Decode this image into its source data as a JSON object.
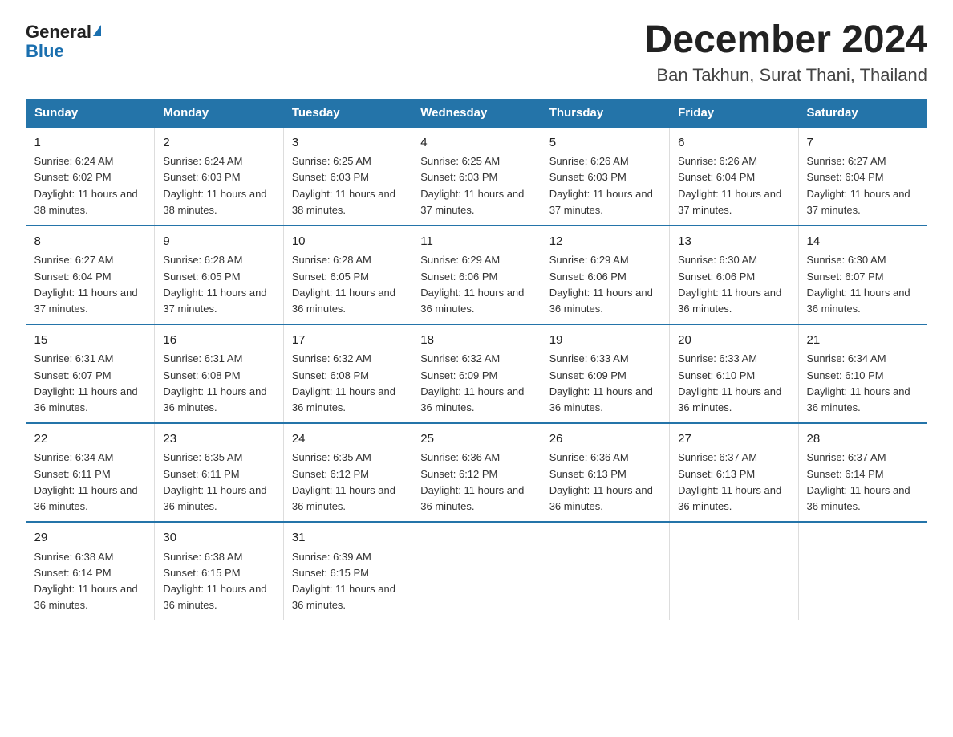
{
  "header": {
    "logo": {
      "general": "General",
      "blue": "Blue",
      "triangle": true
    },
    "title": "December 2024",
    "subtitle": "Ban Takhun, Surat Thani, Thailand"
  },
  "calendar": {
    "days_of_week": [
      "Sunday",
      "Monday",
      "Tuesday",
      "Wednesday",
      "Thursday",
      "Friday",
      "Saturday"
    ],
    "weeks": [
      [
        {
          "day": "1",
          "sunrise": "6:24 AM",
          "sunset": "6:02 PM",
          "daylight": "11 hours and 38 minutes."
        },
        {
          "day": "2",
          "sunrise": "6:24 AM",
          "sunset": "6:03 PM",
          "daylight": "11 hours and 38 minutes."
        },
        {
          "day": "3",
          "sunrise": "6:25 AM",
          "sunset": "6:03 PM",
          "daylight": "11 hours and 38 minutes."
        },
        {
          "day": "4",
          "sunrise": "6:25 AM",
          "sunset": "6:03 PM",
          "daylight": "11 hours and 37 minutes."
        },
        {
          "day": "5",
          "sunrise": "6:26 AM",
          "sunset": "6:03 PM",
          "daylight": "11 hours and 37 minutes."
        },
        {
          "day": "6",
          "sunrise": "6:26 AM",
          "sunset": "6:04 PM",
          "daylight": "11 hours and 37 minutes."
        },
        {
          "day": "7",
          "sunrise": "6:27 AM",
          "sunset": "6:04 PM",
          "daylight": "11 hours and 37 minutes."
        }
      ],
      [
        {
          "day": "8",
          "sunrise": "6:27 AM",
          "sunset": "6:04 PM",
          "daylight": "11 hours and 37 minutes."
        },
        {
          "day": "9",
          "sunrise": "6:28 AM",
          "sunset": "6:05 PM",
          "daylight": "11 hours and 37 minutes."
        },
        {
          "day": "10",
          "sunrise": "6:28 AM",
          "sunset": "6:05 PM",
          "daylight": "11 hours and 36 minutes."
        },
        {
          "day": "11",
          "sunrise": "6:29 AM",
          "sunset": "6:06 PM",
          "daylight": "11 hours and 36 minutes."
        },
        {
          "day": "12",
          "sunrise": "6:29 AM",
          "sunset": "6:06 PM",
          "daylight": "11 hours and 36 minutes."
        },
        {
          "day": "13",
          "sunrise": "6:30 AM",
          "sunset": "6:06 PM",
          "daylight": "11 hours and 36 minutes."
        },
        {
          "day": "14",
          "sunrise": "6:30 AM",
          "sunset": "6:07 PM",
          "daylight": "11 hours and 36 minutes."
        }
      ],
      [
        {
          "day": "15",
          "sunrise": "6:31 AM",
          "sunset": "6:07 PM",
          "daylight": "11 hours and 36 minutes."
        },
        {
          "day": "16",
          "sunrise": "6:31 AM",
          "sunset": "6:08 PM",
          "daylight": "11 hours and 36 minutes."
        },
        {
          "day": "17",
          "sunrise": "6:32 AM",
          "sunset": "6:08 PM",
          "daylight": "11 hours and 36 minutes."
        },
        {
          "day": "18",
          "sunrise": "6:32 AM",
          "sunset": "6:09 PM",
          "daylight": "11 hours and 36 minutes."
        },
        {
          "day": "19",
          "sunrise": "6:33 AM",
          "sunset": "6:09 PM",
          "daylight": "11 hours and 36 minutes."
        },
        {
          "day": "20",
          "sunrise": "6:33 AM",
          "sunset": "6:10 PM",
          "daylight": "11 hours and 36 minutes."
        },
        {
          "day": "21",
          "sunrise": "6:34 AM",
          "sunset": "6:10 PM",
          "daylight": "11 hours and 36 minutes."
        }
      ],
      [
        {
          "day": "22",
          "sunrise": "6:34 AM",
          "sunset": "6:11 PM",
          "daylight": "11 hours and 36 minutes."
        },
        {
          "day": "23",
          "sunrise": "6:35 AM",
          "sunset": "6:11 PM",
          "daylight": "11 hours and 36 minutes."
        },
        {
          "day": "24",
          "sunrise": "6:35 AM",
          "sunset": "6:12 PM",
          "daylight": "11 hours and 36 minutes."
        },
        {
          "day": "25",
          "sunrise": "6:36 AM",
          "sunset": "6:12 PM",
          "daylight": "11 hours and 36 minutes."
        },
        {
          "day": "26",
          "sunrise": "6:36 AM",
          "sunset": "6:13 PM",
          "daylight": "11 hours and 36 minutes."
        },
        {
          "day": "27",
          "sunrise": "6:37 AM",
          "sunset": "6:13 PM",
          "daylight": "11 hours and 36 minutes."
        },
        {
          "day": "28",
          "sunrise": "6:37 AM",
          "sunset": "6:14 PM",
          "daylight": "11 hours and 36 minutes."
        }
      ],
      [
        {
          "day": "29",
          "sunrise": "6:38 AM",
          "sunset": "6:14 PM",
          "daylight": "11 hours and 36 minutes."
        },
        {
          "day": "30",
          "sunrise": "6:38 AM",
          "sunset": "6:15 PM",
          "daylight": "11 hours and 36 minutes."
        },
        {
          "day": "31",
          "sunrise": "6:39 AM",
          "sunset": "6:15 PM",
          "daylight": "11 hours and 36 minutes."
        },
        null,
        null,
        null,
        null
      ]
    ]
  }
}
